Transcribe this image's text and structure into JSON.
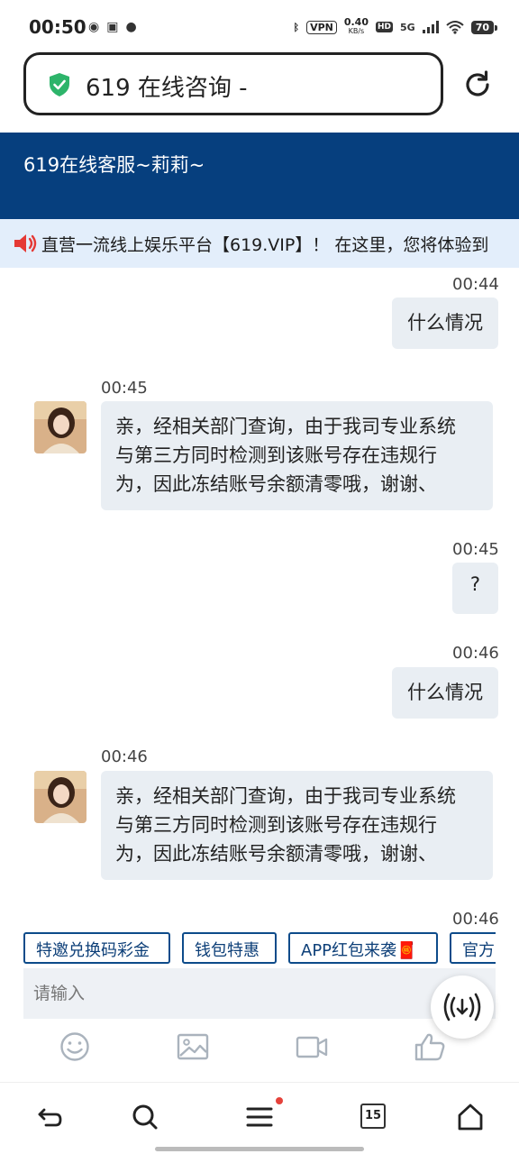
{
  "status": {
    "time": "00:50",
    "vpn": "VPN",
    "speed_value": "0.40",
    "speed_unit": "KB/s",
    "hd": "HD",
    "network": "5G",
    "battery": "70"
  },
  "address_bar": {
    "text": "619 在线咨询 -"
  },
  "header": {
    "title": "619在线客服~莉莉~"
  },
  "marquee": {
    "text": "直营一流线上娱乐平台【619.VIP】！ 在这里，您将体验到"
  },
  "messages": [
    {
      "side": "right",
      "time": "00:44",
      "text": "什么情况"
    },
    {
      "side": "left",
      "time": "00:45",
      "lines": [
        "亲，经相关部门查询，由于我司专业系统",
        "与第三方同时检测到该账号存在违规行",
        "为，因此冻结账号余额清零哦，谢谢、"
      ]
    },
    {
      "side": "right",
      "time": "00:45",
      "text": "?"
    },
    {
      "side": "right",
      "time": "00:46",
      "text": "什么情况"
    },
    {
      "side": "left",
      "time": "00:46",
      "lines": [
        "亲，经相关部门查询，由于我司专业系统",
        "与第三方同时检测到该账号存在违规行",
        "为，因此冻结账号余额清零哦，谢谢、"
      ]
    },
    {
      "side": "right",
      "time": "00:46"
    }
  ],
  "quick_buttons": [
    "特邀兑换码彩金",
    "钱包特惠",
    "APP红包来袭🧧",
    "官方"
  ],
  "input": {
    "placeholder": "请输入"
  },
  "nav": {
    "tab_count": "15"
  },
  "colors": {
    "header_bg": "#063f7e",
    "marquee_bg": "#e3eefb",
    "bubble_bg": "#e9eef3",
    "shield": "#2db46a",
    "speaker": "#e53935",
    "nav_dot": "#e5423b"
  }
}
